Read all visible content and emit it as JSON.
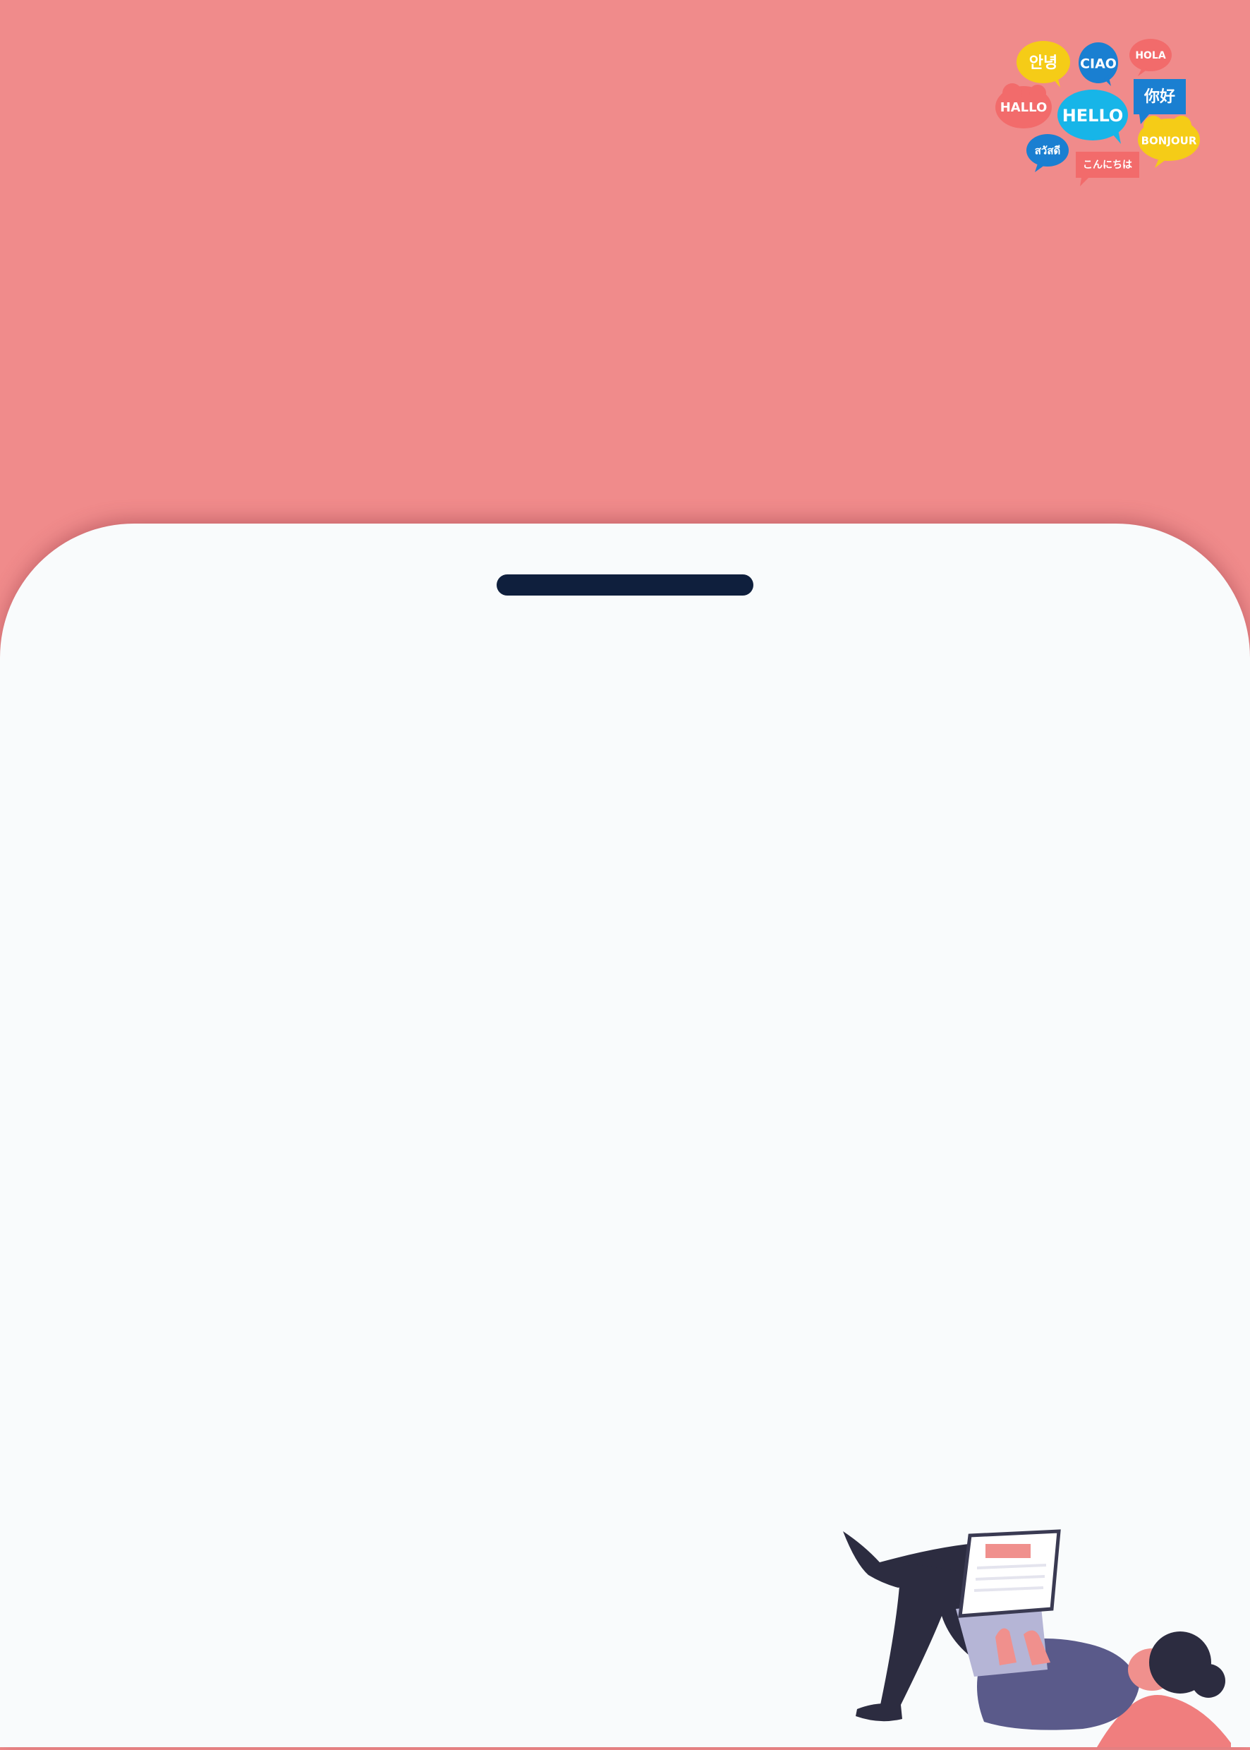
{
  "greetings": {
    "korean": "안녕",
    "italian": "CIAO",
    "spanish": "HOLA",
    "german": "HALLO",
    "english": "HELLO",
    "chinese": "你好",
    "thai": "สวัสดี",
    "french": "BONJOUR",
    "japanese": "こんにちは"
  },
  "colors": {
    "background": "#f08b8b",
    "sheet": "#f9fbfc",
    "handle": "#0f1f3d",
    "bubble_yellow": "#f5cc17",
    "bubble_blue": "#1a7fd1",
    "bubble_cyan": "#17b5e8",
    "bubble_red": "#f26b6b"
  },
  "icons": {
    "greeting_cloud": "multilingual-greetings-icon",
    "illustration": "person-lying-with-laptop-illustration"
  }
}
